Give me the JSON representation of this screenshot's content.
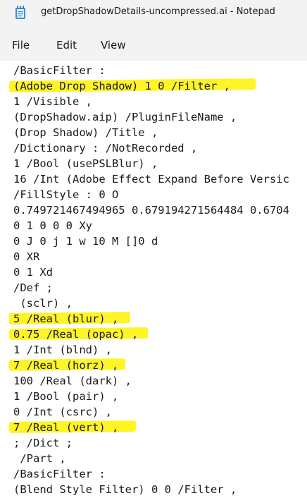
{
  "window": {
    "title": "getDropShadowDetails-uncompressed.ai - Notepad"
  },
  "menu": {
    "file": "File",
    "edit": "Edit",
    "view": "View"
  },
  "lines": [
    "/BasicFilter :",
    "(Adobe Drop Shadow) 1 0 /Filter ,",
    "1 /Visible ,",
    "(DropShadow.aip) /PluginFileName ,",
    "(Drop Shadow) /Title ,",
    "/Dictionary : /NotRecorded ,",
    "1 /Bool (usePSLBlur) ,",
    "16 /Int (Adobe Effect Expand Before Versic",
    "/FillStyle : 0 O",
    "0.749721467494965 0.679194271564484 0.6704",
    "0 1 0 0 0 Xy",
    "0 J 0 j 1 w 10 M []0 d",
    "0 XR",
    "0 1 Xd",
    "/Def ;",
    " (sclr) ,",
    "5 /Real (blur) ,",
    "0.75 /Real (opac) ,",
    "1 /Int (blnd) ,",
    "7 /Real (horz) ,",
    "100 /Real (dark) ,",
    "1 /Bool (pair) ,",
    "0 /Int (csrc) ,",
    "7 /Real (vert) ,",
    "; /Dict ;",
    " /Part ,",
    "/BasicFilter :",
    "(Blend Style Filter) 0 0 /Filter ,"
  ],
  "highlight_color": "#fff200",
  "icons": {
    "app": "notepad-icon"
  }
}
